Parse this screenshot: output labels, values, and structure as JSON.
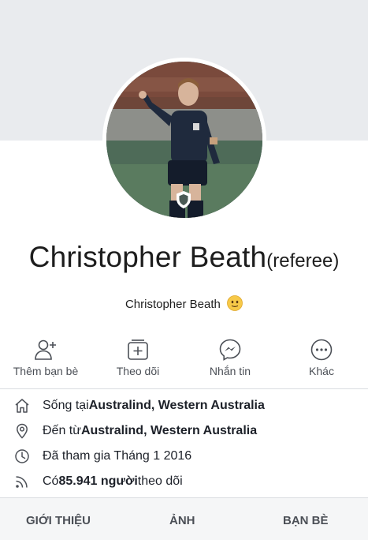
{
  "profile": {
    "name": "Christopher Beath",
    "name_suffix": "(referee)",
    "subtitle": "Christopher Beath",
    "subtitle_emoji": "smiling-face-icon"
  },
  "actions": [
    {
      "label": "Thêm bạn bè",
      "icon": "add-friend-icon"
    },
    {
      "label": "Theo dõi",
      "icon": "follow-icon"
    },
    {
      "label": "Nhắn tin",
      "icon": "messenger-icon"
    },
    {
      "label": "Khác",
      "icon": "more-icon"
    }
  ],
  "info": {
    "lives_prefix": "Sống tại ",
    "lives_place": "Australind, Western Australia",
    "from_prefix": "Đến từ ",
    "from_place": "Australind, Western Australia",
    "joined": "Đã tham gia Tháng 1 2016",
    "followers_prefix": "Có ",
    "followers_count": "85.941 người",
    "followers_suffix": " theo dõi"
  },
  "tabs": [
    {
      "label": "GIỚI THIỆU"
    },
    {
      "label": "ẢNH"
    },
    {
      "label": "BẠN BÈ"
    }
  ],
  "colors": {
    "cover": "#e9ebee",
    "icon": "#4b4f56",
    "text": "#1d2129"
  }
}
